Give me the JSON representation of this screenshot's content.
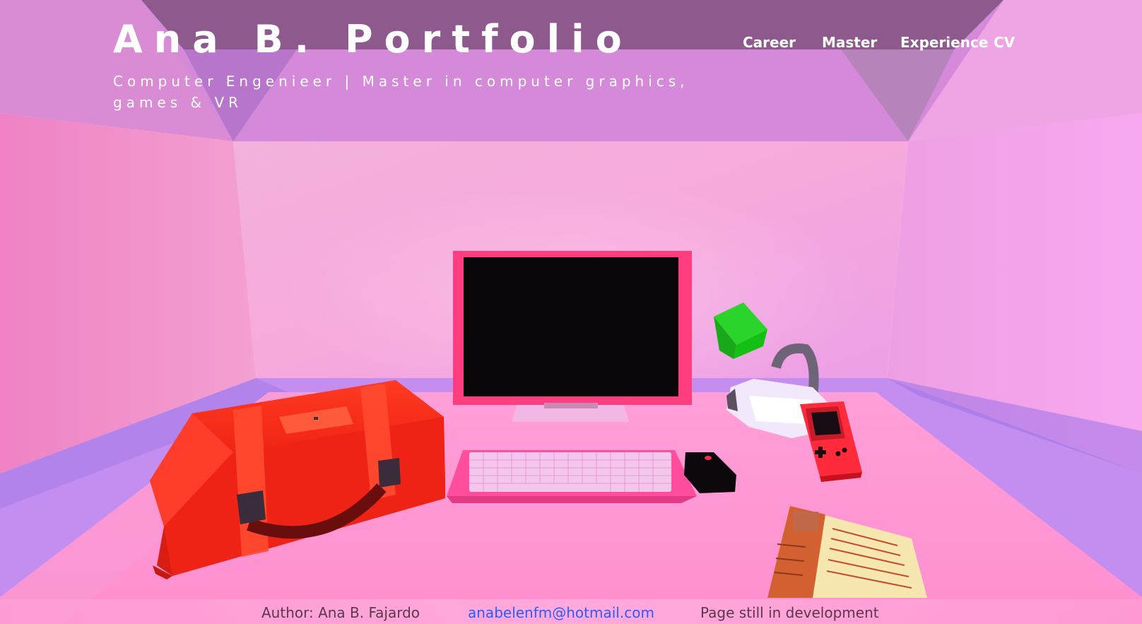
{
  "header": {
    "title": "Ana B. Portfolio",
    "subtitle": "Computer Engenieer | Master in computer graphics, games & VR"
  },
  "nav": {
    "items": [
      {
        "label": "Career"
      },
      {
        "label": "Master"
      },
      {
        "label": "Experience"
      },
      {
        "label": "CV"
      }
    ]
  },
  "footer": {
    "author": "Author: Ana B. Fajardo",
    "email": "anabelenfm@hotmail.com",
    "status": "Page still in development"
  },
  "scene": {
    "objects": [
      "suitcase",
      "monitor",
      "keyboard",
      "mouse",
      "green-cube",
      "vr-headset",
      "gameboy",
      "cv-paper"
    ]
  },
  "colors": {
    "accent_title": "#ffffff",
    "link": "#2a5cff",
    "room_pink": "#f3a6d8",
    "floor_purple": "#c48ef0",
    "suitcase_red": "#f0281a",
    "monitor_frame": "#ff3d7f"
  }
}
